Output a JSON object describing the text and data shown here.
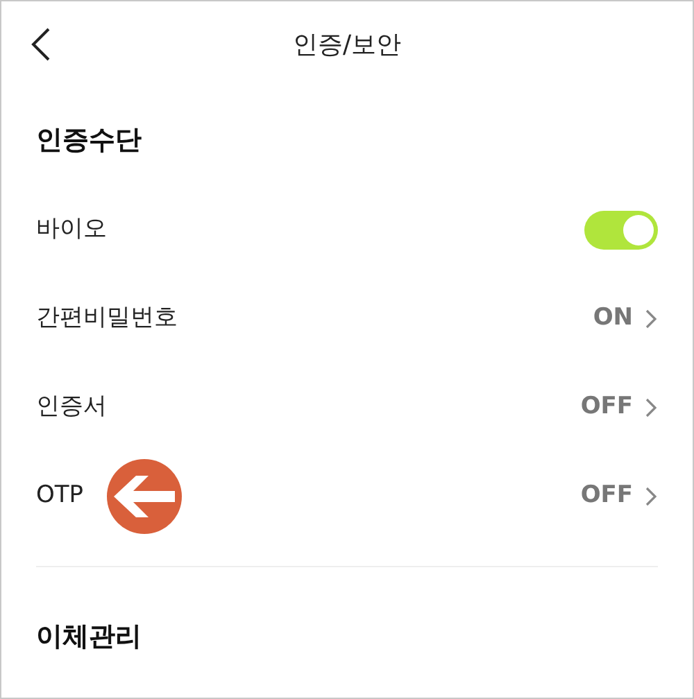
{
  "header": {
    "title": "인증/보안"
  },
  "sections": [
    {
      "title": "인증수단",
      "rows": [
        {
          "kind": "toggle",
          "label": "바이오",
          "on": true
        },
        {
          "kind": "value",
          "label": "간편비밀번호",
          "value": "ON"
        },
        {
          "kind": "value",
          "label": "인증서",
          "value": "OFF"
        },
        {
          "kind": "value",
          "label": "OTP",
          "value": "OFF",
          "callout": true
        }
      ]
    },
    {
      "title": "이체관리"
    }
  ]
}
